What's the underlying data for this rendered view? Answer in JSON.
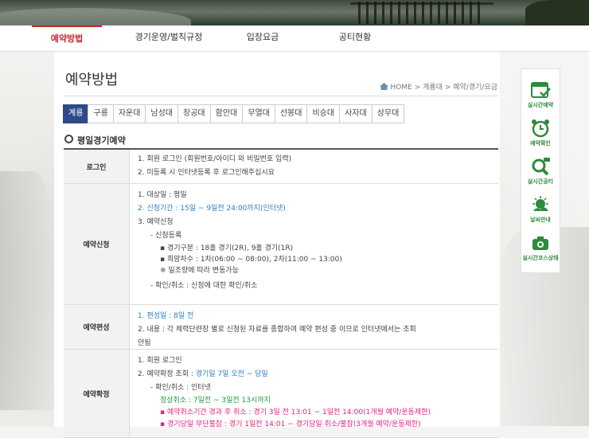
{
  "nav": [
    "예약방법",
    "경기운영/벌칙규정",
    "입장요금",
    "공티현황"
  ],
  "page": {
    "title": "예약방법"
  },
  "breadcrumb": {
    "home": "HOME",
    "path": "계룡대 > 예약/경기/요금"
  },
  "courses": [
    "계룡",
    "구룡",
    "자운대",
    "남성대",
    "창공대",
    "함안대",
    "무열대",
    "선봉대",
    "비승대",
    "사자대",
    "상무대"
  ],
  "section_title": "평일경기예약",
  "table": {
    "login": {
      "label": "로그인",
      "lines": [
        "1. 회원 로그인 (회원번호/아이디 와 비밀번호 입력)",
        "2. 미등록 시 인터넷등록 후 로그인해주십시요"
      ]
    },
    "apply": {
      "label": "예약신청",
      "l1": "1. 대상일 : 평일",
      "l2": "2. 신청기간 : 15일 ~ 9일전 24:00까지(인터넷)",
      "l3": "3. 예약신청",
      "l4": "- 신청등록",
      "l5": "▪ 경기구분 : 18홀 경기(2R), 9홀 경기(1R)",
      "l6": "▪ 희망차수 : 1차(06:00 ~ 08:00), 2차(11:00 ~ 13:00)",
      "l7": "※ 일조량에 따라 변동가능",
      "l8": "- 확인/취소 : 신청에 대한 확인/취소"
    },
    "form": {
      "label": "예약편성",
      "l1": "1. 편성일 : 8일 전",
      "l2": "2. 내용 : 각 체력단련장 별로 신청된 자료를 종합하여 예약 편성 중 이므로 인터넷에서는 조회",
      "l3": "안됨"
    },
    "confirm": {
      "label": "예약확정",
      "l1": "1. 회원 로그인",
      "l2a": "2. 예약확정 조회 : ",
      "l2b": "경기일 7일 오전 ~ 당일",
      "l3": "- 확인/취소 : 인터넷",
      "l4": "정상취소 : 7일전 ~ 3일전 13시까지",
      "l5": "▪ 예약취소기간 경과 후 취소 : 경기 3일 전 13:01 ~ 1일전 14:00(1개월 예약/운동제한)",
      "l6": "▪ 경기당일 무단불참 : 경기 1일전 14:01 ~ 경기당일 취소/불참(3개월 예약/운동제한)"
    }
  },
  "quick": [
    "실시간예약",
    "예약확인",
    "실시간공티",
    "날씨안내",
    "실시간코스상태"
  ],
  "colors": {
    "brand_red": "#c0282e",
    "active_tab": "#2e4a8a",
    "info_blue": "#2a7fc4",
    "cancel_green": "#1d9a3e",
    "warn_pink": "#e0267a",
    "quick_green": "#2f8a3c"
  }
}
